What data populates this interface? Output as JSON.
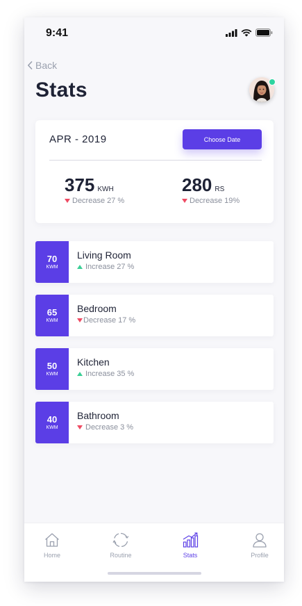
{
  "status_bar": {
    "time": "9:41"
  },
  "nav_back": {
    "label": "Back"
  },
  "page": {
    "title": "Stats"
  },
  "summary": {
    "month": "APR - 2019",
    "choose_date_label": "Choose Date",
    "energy": {
      "value": "375",
      "unit": "KWH",
      "delta": "Decrease 27 %",
      "direction": "down"
    },
    "cost": {
      "value": "280",
      "unit": "RS",
      "delta": "Decrease 19%",
      "direction": "down"
    }
  },
  "rooms": [
    {
      "value": "70",
      "unit": "KWM",
      "name": "Living Room",
      "delta": "Increase 27 %",
      "direction": "up"
    },
    {
      "value": "65",
      "unit": "KWM",
      "name": "Bedroom",
      "delta": "Decrease 17 %",
      "direction": "down"
    },
    {
      "value": "50",
      "unit": "KWM",
      "name": "Kitchen",
      "delta": "Increase 35 %",
      "direction": "up"
    },
    {
      "value": "40",
      "unit": "KWM",
      "name": "Bathroom",
      "delta": "Decrease 3 %",
      "direction": "down"
    }
  ],
  "bottom_nav": [
    {
      "label": "Home",
      "icon": "home-icon",
      "active": false
    },
    {
      "label": "Routine",
      "icon": "routine-icon",
      "active": false
    },
    {
      "label": "Stats",
      "icon": "stats-icon",
      "active": true
    },
    {
      "label": "Profile",
      "icon": "profile-icon",
      "active": false
    }
  ],
  "colors": {
    "accent": "#5b3ee6",
    "increase": "#3ccf96",
    "decrease": "#ee4b63",
    "online": "#2dd4a0"
  }
}
